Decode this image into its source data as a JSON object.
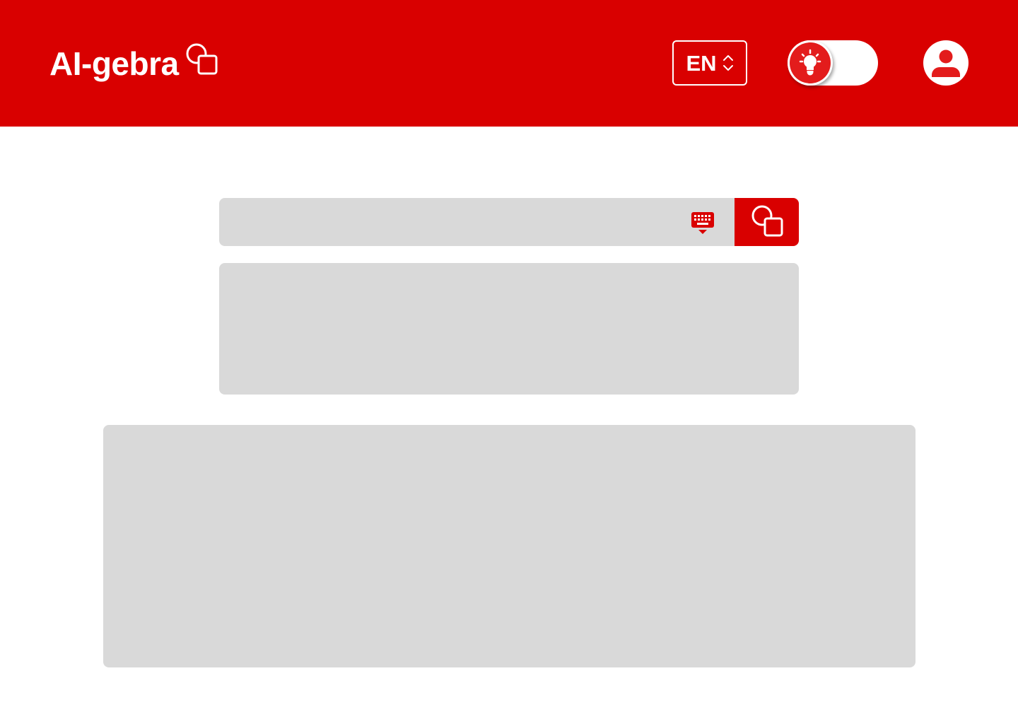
{
  "header": {
    "title": "AI-gebra",
    "logo_icon": "shapes-logo-icon",
    "background_color": "#d90000",
    "language": {
      "selected": "EN",
      "icon": "chevron-up-down-icon"
    },
    "theme_toggle": {
      "state": "light",
      "icon": "lightbulb-icon"
    },
    "account": {
      "icon": "user-icon"
    }
  },
  "search": {
    "value": "",
    "placeholder": "",
    "keyboard_icon": "keyboard-icon",
    "submit_icon": "shapes-icon",
    "accent_color": "#d90000"
  },
  "panels": {
    "placeholder_color": "#d9d9d9"
  }
}
